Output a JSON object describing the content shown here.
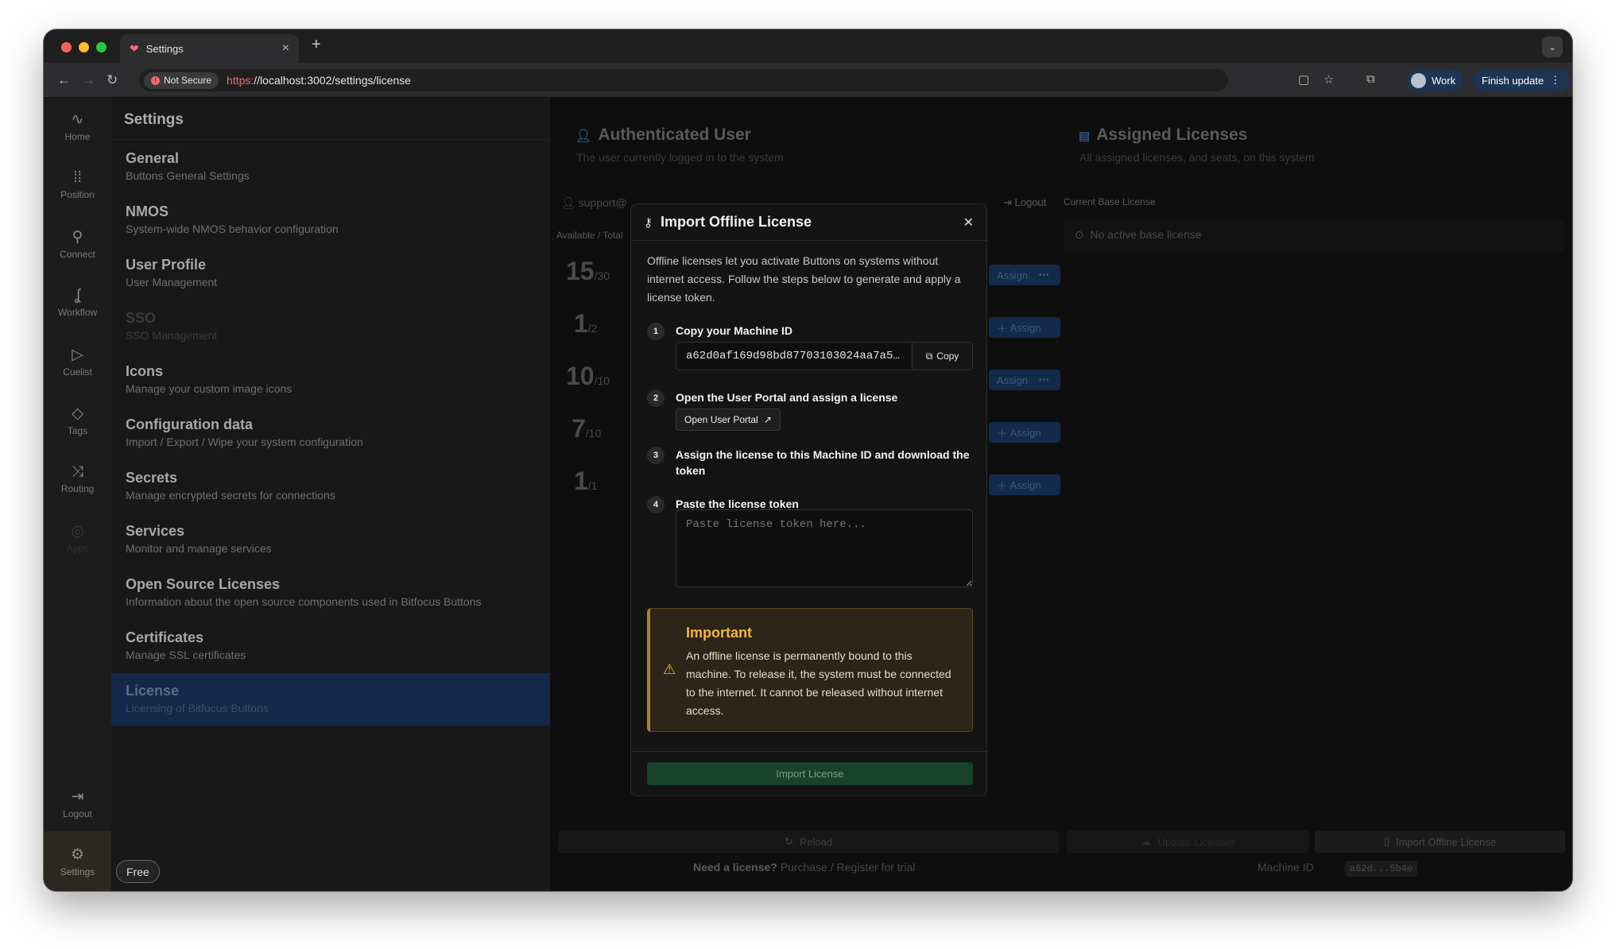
{
  "browser": {
    "tab_title": "Settings",
    "security_label": "Not Secure",
    "url_scheme": "https:",
    "url_rest": "//localhost:3002/settings/license",
    "profile_label": "Work",
    "finish_update_label": "Finish update"
  },
  "rail": {
    "items": [
      {
        "label": "Home",
        "icon": "pulse-icon"
      },
      {
        "label": "Position",
        "icon": "grid-icon"
      },
      {
        "label": "Connect",
        "icon": "plug-icon"
      },
      {
        "label": "Workflow",
        "icon": "workflow-icon"
      },
      {
        "label": "Cuelist",
        "icon": "play-icon"
      },
      {
        "label": "Tags",
        "icon": "tag-icon"
      },
      {
        "label": "Routing",
        "icon": "shuffle-icon"
      },
      {
        "label": "Apps",
        "icon": "apps-icon"
      }
    ],
    "logout_label": "Logout",
    "settings_label": "Settings"
  },
  "sidebar": {
    "title": "Settings",
    "items": [
      {
        "title": "General",
        "desc": "Buttons General Settings"
      },
      {
        "title": "NMOS",
        "desc": "System-wide NMOS behavior configuration"
      },
      {
        "title": "User Profile",
        "desc": "User Management"
      },
      {
        "title": "SSO",
        "desc": "SSO Management"
      },
      {
        "title": "Icons",
        "desc": "Manage your custom image icons"
      },
      {
        "title": "Configuration data",
        "desc": "Import / Export / Wipe your system configuration"
      },
      {
        "title": "Secrets",
        "desc": "Manage encrypted secrets for connections"
      },
      {
        "title": "Services",
        "desc": "Monitor and manage services"
      },
      {
        "title": "Open Source Licenses",
        "desc": "Information about the open source components used in Bitfocus Buttons"
      },
      {
        "title": "Certificates",
        "desc": "Manage SSL certificates"
      },
      {
        "title": "License",
        "desc": "Licensing of Bitfocus Buttons"
      }
    ],
    "badge": "Free"
  },
  "main": {
    "auth_title": "Authenticated User",
    "auth_sub": "The user currently logged in to the system",
    "user_prefix": "support@",
    "logout_label": "Logout",
    "avail_total_label": "Available / Total",
    "rows": [
      {
        "count": "15",
        "total": "/30"
      },
      {
        "count": "1",
        "total": "/2"
      },
      {
        "count": "10",
        "total": "/10"
      },
      {
        "count": "7",
        "total": "/10"
      },
      {
        "count": "1",
        "total": "/1"
      }
    ],
    "assign_label": "Assign",
    "assigned_title": "Assigned Licenses",
    "assigned_sub": "All assigned licenses, and seats, on this system",
    "current_base_label": "Current Base License",
    "no_base_label": "No active base license",
    "reload_label": "Reload",
    "update_licenses_label": "Update Licenses",
    "import_offline_label": "Import Offline License",
    "need_license_prefix": "Need a license?",
    "need_license_links": "Purchase / Register for trial",
    "machine_id_label": "Machine ID",
    "machine_id_short": "a62d...5b4e"
  },
  "modal": {
    "title": "Import Offline License",
    "intro": "Offline licenses let you activate Buttons on systems without internet access. Follow the steps below to generate and apply a license token.",
    "steps": [
      {
        "num": "1",
        "label": "Copy your Machine ID"
      },
      {
        "num": "2",
        "label": "Open the User Portal and assign a license"
      },
      {
        "num": "3",
        "label": "Assign the license to this Machine ID and download the token"
      },
      {
        "num": "4",
        "label": "Paste the license token"
      }
    ],
    "machine_id": "a62d0af169d98bd87703103024aa7a5…",
    "copy_label": "Copy",
    "open_portal_label": "Open User Portal",
    "token_placeholder": "Paste license token here...",
    "warning_title": "Important",
    "warning_text": "An offline license is permanently bound to this machine. To release it, the system must be connected to the internet. It cannot be released without internet access.",
    "import_label": "Import License"
  }
}
